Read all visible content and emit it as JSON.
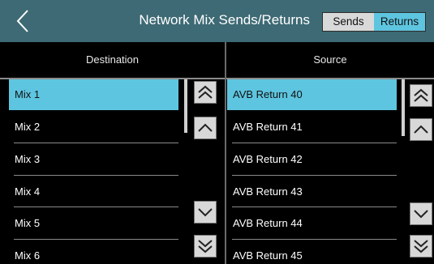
{
  "header": {
    "title": "Network Mix Sends/Returns",
    "sends_label": "Sends",
    "returns_label": "Returns",
    "accent_color": "#5ec5e0",
    "bar_color": "#3d6a74"
  },
  "destination": {
    "heading": "Destination",
    "items": [
      "Mix 1",
      "Mix 2",
      "Mix 3",
      "Mix 4",
      "Mix 5",
      "Mix 6"
    ],
    "selected": "Mix 1"
  },
  "source": {
    "heading": "Source",
    "items": [
      "AVB Return 40",
      "AVB Return 41",
      "AVB Return 42",
      "AVB Return 43",
      "AVB Return 44",
      "AVB Return 45"
    ],
    "selected": "AVB Return 40"
  },
  "icons": {
    "back": "chevron-left-icon",
    "page_up": "double-chevron-up-icon",
    "line_up": "chevron-up-icon",
    "line_down": "chevron-down-icon",
    "page_down": "double-chevron-down-icon"
  }
}
